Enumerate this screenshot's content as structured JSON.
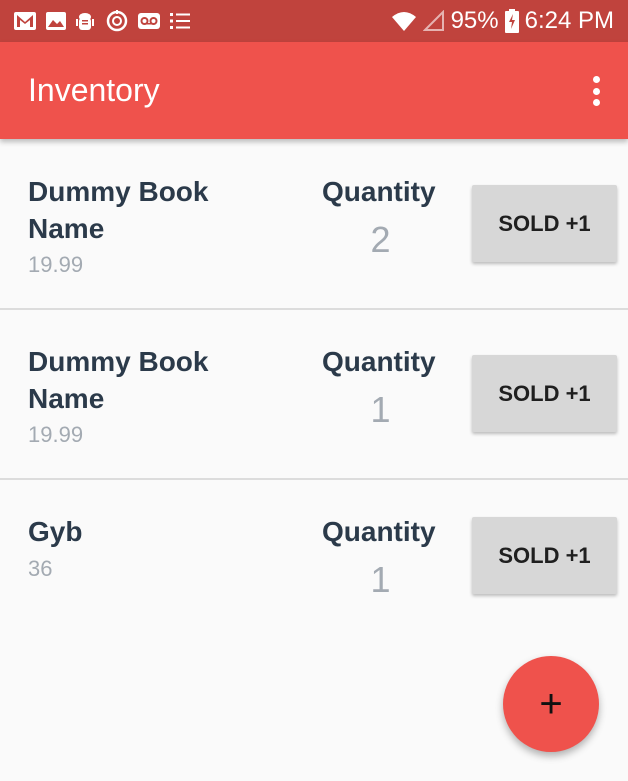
{
  "status_bar": {
    "left_icons": [
      "gmail-icon",
      "photo-icon",
      "android-debug-icon",
      "clock-sync-icon",
      "voicemail-icon",
      "checklist-icon"
    ],
    "battery_percent": "95%",
    "time": "6:24 PM"
  },
  "app_bar": {
    "title": "Inventory",
    "menu_icon": "more-vert-icon"
  },
  "items": [
    {
      "name": "Dummy Book Name",
      "price": "19.99",
      "quantity_label": "Quantity",
      "quantity": "2",
      "button": "SOLD +1"
    },
    {
      "name": "Dummy Book Name",
      "price": "19.99",
      "quantity_label": "Quantity",
      "quantity": "1",
      "button": "SOLD +1"
    },
    {
      "name": "Gyb",
      "price": "36",
      "quantity_label": "Quantity",
      "quantity": "1",
      "button": "SOLD +1"
    }
  ],
  "fab": {
    "label": "+",
    "icon": "add-icon"
  },
  "colors": {
    "primary": "#ef524c",
    "status_bar": "#c0433d",
    "button": "#d7d7d7",
    "text_dark": "#2b3a4a",
    "text_muted": "#a3aab2"
  }
}
